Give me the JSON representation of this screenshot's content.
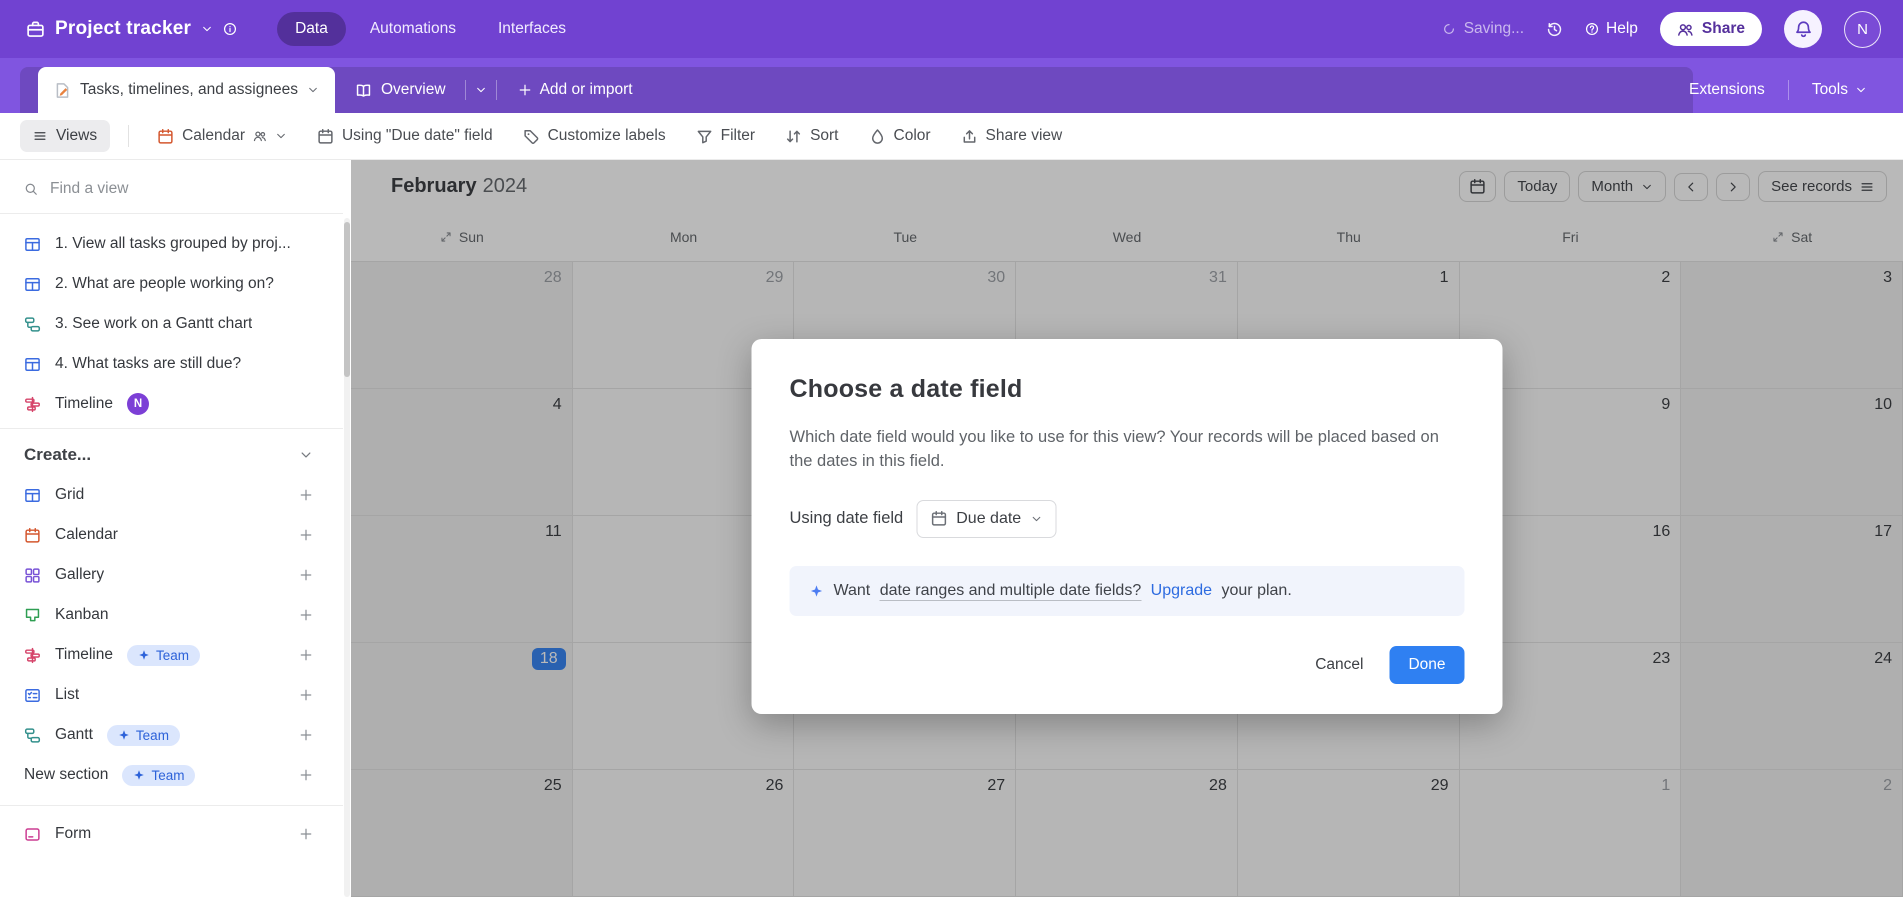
{
  "topbar": {
    "app_title": "Project tracker",
    "nav": [
      {
        "label": "Data",
        "active": true
      },
      {
        "label": "Automations",
        "active": false
      },
      {
        "label": "Interfaces",
        "active": false
      }
    ],
    "saving": "Saving...",
    "help": "Help",
    "share": "Share",
    "avatar_initial": "N"
  },
  "tabbar": {
    "active_tab": "Tasks, timelines, and assignees",
    "overview_tab": "Overview",
    "add_or_import": "Add or import",
    "extensions": "Extensions",
    "tools": "Tools"
  },
  "toolbar": {
    "views": "Views",
    "view_name": "Calendar",
    "using_field": "Using \"Due date\" field",
    "customize_labels": "Customize labels",
    "filter": "Filter",
    "sort": "Sort",
    "color": "Color",
    "share_view": "Share view"
  },
  "sidebar": {
    "search_placeholder": "Find a view",
    "team_badge": "Team",
    "views": [
      {
        "label": "1. View all tasks grouped by proj...",
        "icon": "grid",
        "color": "#3b6be0"
      },
      {
        "label": "2. What are people working on?",
        "icon": "grid",
        "color": "#3b6be0"
      },
      {
        "label": "3. See work on a Gantt chart",
        "icon": "gantt",
        "color": "#33908c"
      },
      {
        "label": "4. What tasks are still due?",
        "icon": "grid",
        "color": "#3b6be0"
      },
      {
        "label": "Timeline",
        "icon": "timeline",
        "color": "#d5446a",
        "badge": "N"
      }
    ],
    "create_header": "Create...",
    "create_items": [
      {
        "label": "Grid",
        "icon": "grid",
        "color": "#3b6be0"
      },
      {
        "label": "Calendar",
        "icon": "calendar",
        "color": "#d4572f"
      },
      {
        "label": "Gallery",
        "icon": "gallery",
        "color": "#7852d6"
      },
      {
        "label": "Kanban",
        "icon": "kanban",
        "color": "#2e9e52"
      },
      {
        "label": "Timeline",
        "icon": "timeline",
        "color": "#d5446a",
        "team": true
      },
      {
        "label": "List",
        "icon": "list",
        "color": "#3b6be0"
      },
      {
        "label": "Gantt",
        "icon": "gantt",
        "color": "#33908c",
        "team": true
      },
      {
        "label": "New section",
        "team": true
      }
    ],
    "form_item": {
      "label": "Form",
      "icon": "form",
      "color": "#cc3d92"
    }
  },
  "calendar": {
    "month_title": "February",
    "year": "2024",
    "today_label": "Today",
    "scale_label": "Month",
    "see_records_label": "See records",
    "day_headers": [
      "Sun",
      "Mon",
      "Tue",
      "Wed",
      "Thu",
      "Fri",
      "Sat"
    ],
    "rows": [
      {
        "cells": [
          {
            "day": "28",
            "muted": true
          },
          {
            "day": "29",
            "muted": true
          },
          {
            "day": "30",
            "muted": true
          },
          {
            "day": "31",
            "muted": true
          },
          {
            "day": "1"
          },
          {
            "day": "2"
          },
          {
            "day": "3"
          }
        ]
      },
      {
        "cells": [
          {
            "day": "4"
          },
          {},
          {},
          {},
          {},
          {
            "day": "9"
          },
          {
            "day": "10"
          }
        ]
      },
      {
        "cells": [
          {
            "day": "11"
          },
          {},
          {},
          {},
          {},
          {
            "day": "16"
          },
          {
            "day": "17"
          }
        ]
      },
      {
        "cells": [
          {
            "day": "18",
            "selected": true
          },
          {},
          {},
          {},
          {},
          {
            "day": "23"
          },
          {
            "day": "24"
          }
        ]
      },
      {
        "cells": [
          {
            "day": "25"
          },
          {
            "day": "26"
          },
          {
            "day": "27"
          },
          {
            "day": "28"
          },
          {
            "day": "29"
          },
          {
            "day": "1",
            "muted": true
          },
          {
            "day": "2",
            "muted": true
          }
        ]
      }
    ]
  },
  "modal": {
    "title": "Choose a date field",
    "body": "Which date field would you like to use for this view? Your records will be placed based on the dates in this field.",
    "using_label": "Using date field",
    "field_value": "Due date",
    "notice_intro": "Want",
    "notice_underline": "date ranges and multiple date fields?",
    "notice_link": "Upgrade",
    "notice_suffix": "your plan.",
    "cancel": "Cancel",
    "done": "Done"
  },
  "colors": {
    "topbar_purple": "#7142d1",
    "tabbar_purple": "#8055e0",
    "accent_blue": "#2f80f2",
    "selected_day_blue": "#2f80f2",
    "team_badge_bg": "#dbe6fd",
    "team_badge_text": "#2d62d9",
    "new_badge_purple": "#7c3fd6"
  }
}
